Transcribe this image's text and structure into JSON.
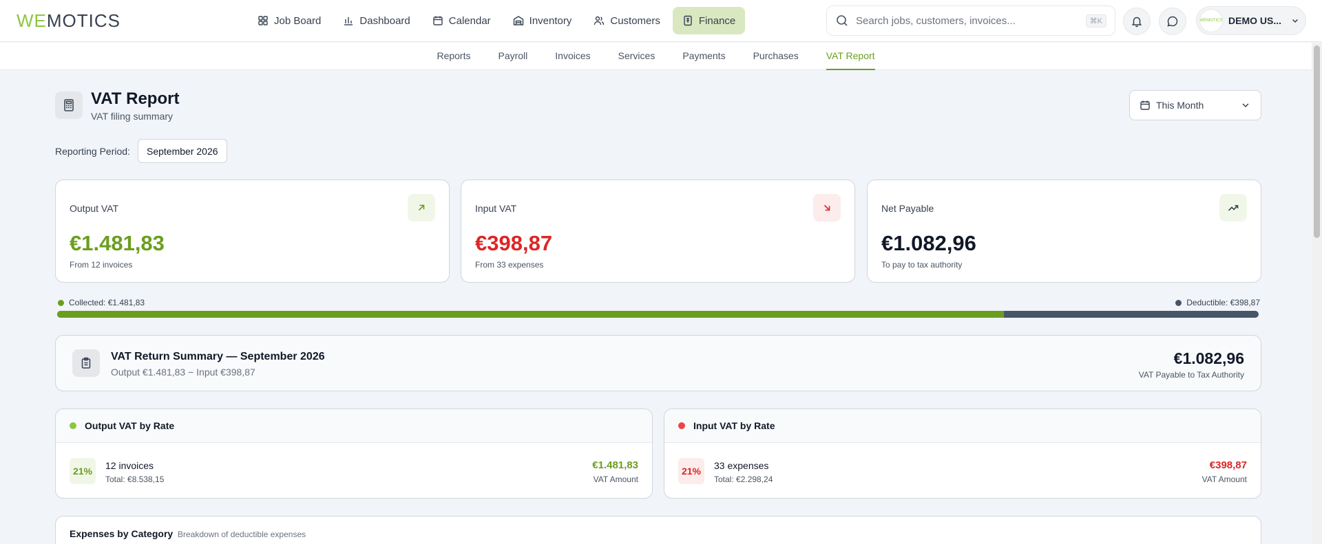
{
  "brand": {
    "logo_we": "WE",
    "logo_rest": "MOTICS",
    "avatar_text": "WEMOTICS"
  },
  "nav": {
    "items": [
      {
        "label": "Job Board",
        "icon": "grid-icon"
      },
      {
        "label": "Dashboard",
        "icon": "bar-chart-icon"
      },
      {
        "label": "Calendar",
        "icon": "calendar-icon"
      },
      {
        "label": "Inventory",
        "icon": "warehouse-icon"
      },
      {
        "label": "Customers",
        "icon": "users-icon"
      },
      {
        "label": "Finance",
        "icon": "receipt-icon",
        "active": true
      }
    ]
  },
  "search": {
    "placeholder": "Search jobs, customers, invoices...",
    "shortcut": "⌘K"
  },
  "user": {
    "name": "DEMO US..."
  },
  "subnav": {
    "items": [
      "Reports",
      "Payroll",
      "Invoices",
      "Services",
      "Payments",
      "Purchases",
      "VAT Report"
    ],
    "active": "VAT Report"
  },
  "header": {
    "title": "VAT Report",
    "subtitle": "VAT filing summary",
    "period_select": "This Month"
  },
  "reporting_period": {
    "label": "Reporting Period:",
    "value": "September 2026"
  },
  "cards": [
    {
      "title": "Output VAT",
      "value": "€1.481,83",
      "sub": "From 12 invoices",
      "color": "#6b9e1f",
      "icon": "arrow-up-right-icon"
    },
    {
      "title": "Input VAT",
      "value": "€398,87",
      "sub": "From 33 expenses",
      "color": "#dc2626",
      "icon": "arrow-down-right-icon"
    },
    {
      "title": "Net Payable",
      "value": "€1.082,96",
      "sub": "To pay to tax authority",
      "color": "#111827",
      "icon": "trending-up-icon"
    }
  ],
  "progress": {
    "collected_label": "Collected: €1.481,83",
    "deductible_label": "Deductible: €398,87",
    "collected_fraction": 0.788
  },
  "summary": {
    "title": "VAT Return Summary — September 2026",
    "subtitle": "Output €1.481,83 − Input €398,87",
    "amount": "€1.082,96",
    "note": "VAT Payable to Tax Authority"
  },
  "output_rate": {
    "title": "Output VAT by Rate",
    "rate": "21%",
    "count": "12 invoices",
    "total": "Total: €8.538,15",
    "amount": "€1.481,83",
    "note": "VAT Amount"
  },
  "input_rate": {
    "title": "Input VAT by Rate",
    "rate": "21%",
    "count": "33 expenses",
    "total": "Total: €2.298,24",
    "amount": "€398,87",
    "note": "VAT Amount"
  },
  "expenses": {
    "title": "Expenses by Category",
    "subtitle": "Breakdown of deductible expenses"
  },
  "colors": {
    "accent": "#6b9e1f",
    "danger": "#dc2626",
    "slate": "#475569"
  }
}
